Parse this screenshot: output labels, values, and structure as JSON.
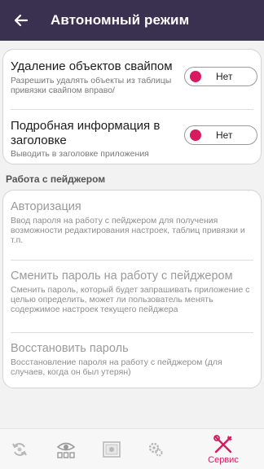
{
  "header": {
    "title": "Автономный режим"
  },
  "settings": [
    {
      "title": "Удаление объектов свайпом",
      "subtitle": "Разрешить удалять объекты из таблицы привязки свайпом вправо/",
      "toggle": "Нет"
    },
    {
      "title_line1": "Подробная информация в",
      "title_line2": "заголовке",
      "subtitle": "Выводить в заголовке приложения",
      "toggle": "Нет"
    }
  ],
  "pager_section": {
    "title": "Работа с пейджером",
    "items": [
      {
        "title": "Авторизация",
        "subtitle": "Ввод пароля на работу с пейджером для получения возможности редактирования настроек, таблиц привязки и т.п."
      },
      {
        "title": "Сменить пароль на работу с пейджером",
        "subtitle": "Сменить пароль, который будет запрашивать приложение с целью определить, может ли пользователь менять содержимое настроек текущего пейджера"
      },
      {
        "title": "Восстановить пароль",
        "subtitle": "Восстановление пароля на работу с пейджером (для случаев, когда он был утерян)"
      }
    ]
  },
  "bottom_nav": {
    "tabs": [
      {
        "icon": "sync-icon"
      },
      {
        "icon": "monitoring-icon"
      },
      {
        "icon": "image-icon"
      },
      {
        "icon": "gears-icon"
      },
      {
        "icon": "tools-icon",
        "label": "Сервис",
        "active": true
      }
    ]
  },
  "colors": {
    "appbar": "#3a3150",
    "accent": "#d81b60"
  }
}
